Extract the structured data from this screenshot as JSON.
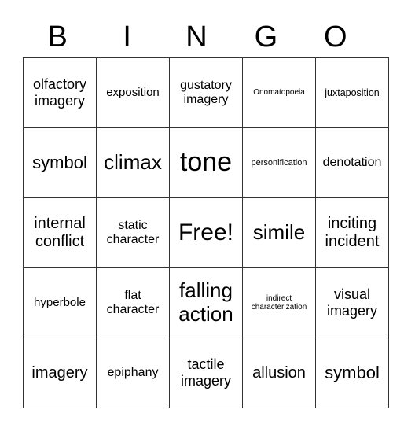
{
  "header": [
    "B",
    "I",
    "N",
    "G",
    "O"
  ],
  "rows": [
    [
      "olfactory imagery",
      "exposition",
      "gustatory imagery",
      "Onomatopoeia",
      "juxtaposition"
    ],
    [
      "symbol",
      "climax",
      "tone",
      "personification",
      "denotation"
    ],
    [
      "internal conflict",
      "static character",
      "Free!",
      "simile",
      "inciting incident"
    ],
    [
      "hyperbole",
      "flat character",
      "falling action",
      "indirect characterization",
      "visual imagery"
    ],
    [
      "imagery",
      "epiphany",
      "tactile imagery",
      "allusion",
      "symbol"
    ]
  ]
}
